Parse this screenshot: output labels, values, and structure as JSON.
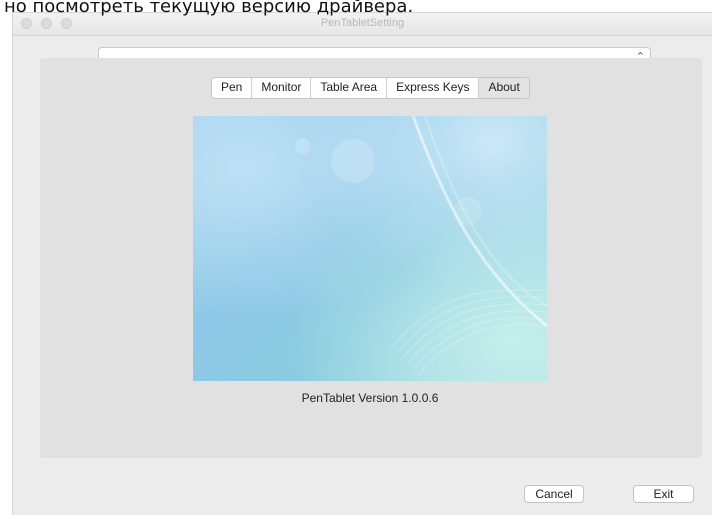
{
  "overlay_caption": "но посмотреть текущую версию драйвера.",
  "window": {
    "title": "PenTabletSetting"
  },
  "device_select": {
    "value": ""
  },
  "tabs": [
    {
      "label": "Pen",
      "active": false
    },
    {
      "label": "Monitor",
      "active": false
    },
    {
      "label": "Table Area",
      "active": false
    },
    {
      "label": "Express Keys",
      "active": false
    },
    {
      "label": "About",
      "active": true
    }
  ],
  "about": {
    "version_text": "PenTablet Version  1.0.0.6"
  },
  "buttons": {
    "cancel": "Cancel",
    "exit": "Exit"
  },
  "icons": {
    "select_chevron": "up-down-chevron-icon"
  }
}
